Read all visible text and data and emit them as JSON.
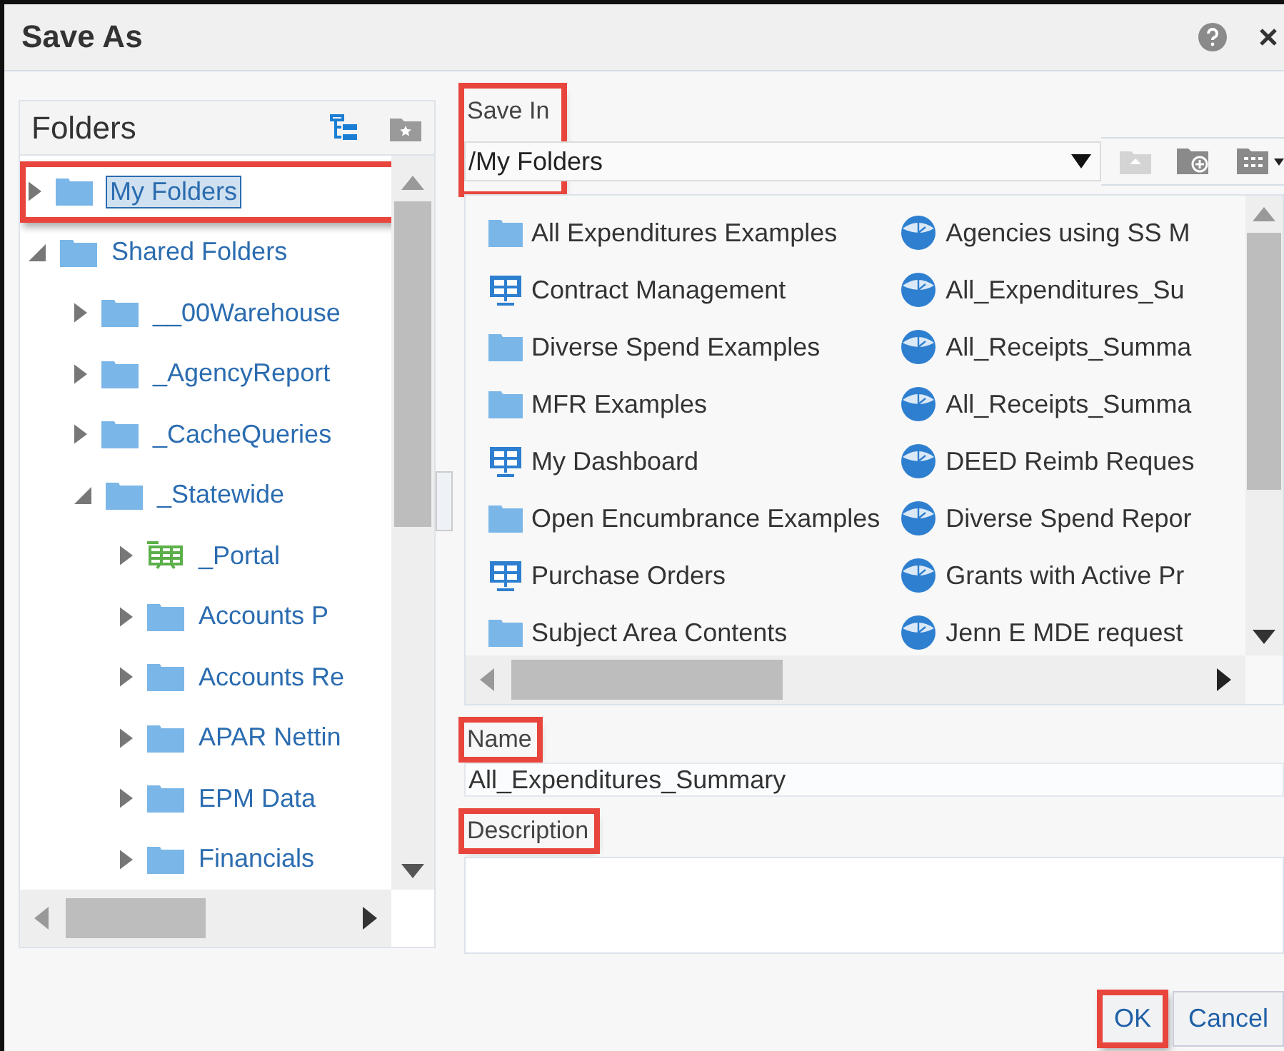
{
  "window": {
    "title": "Save As"
  },
  "folders": {
    "title": "Folders",
    "tree": [
      {
        "label": "My Folders",
        "kind": "folder",
        "expanded": false,
        "selected": true,
        "highlighted": true
      },
      {
        "label": "Shared Folders",
        "kind": "folder",
        "expanded": true,
        "selected": false,
        "highlighted": false,
        "children": [
          {
            "label": "__00Warehouse",
            "kind": "folder",
            "expanded": false,
            "selected": false,
            "highlighted": false
          },
          {
            "label": "_AgencyReport",
            "kind": "folder",
            "expanded": false,
            "selected": false,
            "highlighted": false
          },
          {
            "label": "_CacheQueries",
            "kind": "folder",
            "expanded": false,
            "selected": false,
            "highlighted": false
          },
          {
            "label": "_Statewide",
            "kind": "folder",
            "expanded": true,
            "selected": false,
            "highlighted": false,
            "children": [
              {
                "label": "_Portal",
                "kind": "dashboard",
                "expanded": false,
                "selected": false,
                "highlighted": false
              },
              {
                "label": "Accounts P",
                "kind": "folder",
                "expanded": false,
                "selected": false,
                "highlighted": false
              },
              {
                "label": "Accounts Re",
                "kind": "folder",
                "expanded": false,
                "selected": false,
                "highlighted": false
              },
              {
                "label": "APAR Nettin",
                "kind": "folder",
                "expanded": false,
                "selected": false,
                "highlighted": false
              },
              {
                "label": "EPM Data",
                "kind": "folder",
                "expanded": false,
                "selected": false,
                "highlighted": false
              },
              {
                "label": "Financials",
                "kind": "folder",
                "expanded": false,
                "selected": false,
                "highlighted": false
              }
            ]
          }
        ]
      }
    ]
  },
  "save_in": {
    "label": "Save In",
    "value": "/My Folders",
    "highlighted": true
  },
  "items": [
    {
      "label": "All Expenditures Examples",
      "kind": "folder"
    },
    {
      "label": "Contract Management",
      "kind": "dashboard"
    },
    {
      "label": "Diverse Spend Examples",
      "kind": "folder"
    },
    {
      "label": "MFR Examples",
      "kind": "folder"
    },
    {
      "label": "My Dashboard",
      "kind": "dashboard"
    },
    {
      "label": "Open Encumbrance Examples",
      "kind": "folder"
    },
    {
      "label": "Purchase Orders",
      "kind": "dashboard"
    },
    {
      "label": "Subject Area Contents",
      "kind": "folder"
    },
    {
      "label": "Agencies using SS M",
      "kind": "analysis"
    },
    {
      "label": "All_Expenditures_Su",
      "kind": "analysis"
    },
    {
      "label": "All_Receipts_Summa",
      "kind": "analysis"
    },
    {
      "label": "All_Receipts_Summa",
      "kind": "analysis"
    },
    {
      "label": "DEED Reimb Reques",
      "kind": "analysis"
    },
    {
      "label": "Diverse Spend Repor",
      "kind": "analysis"
    },
    {
      "label": "Grants with Active Pr",
      "kind": "analysis"
    },
    {
      "label": "Jenn E MDE request",
      "kind": "analysis"
    }
  ],
  "name": {
    "label": "Name",
    "value": "All_Expenditures_Summary",
    "highlighted": true
  },
  "description": {
    "label": "Description",
    "highlighted": true
  },
  "buttons": [
    {
      "label": "OK",
      "highlighted": true
    },
    {
      "label": "Cancel",
      "highlighted": false
    }
  ]
}
